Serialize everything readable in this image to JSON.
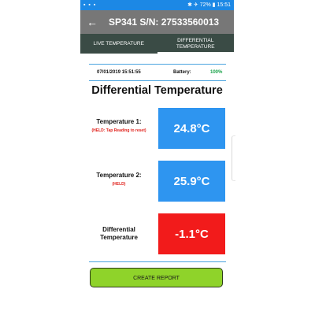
{
  "statusbar": {
    "left_icons": "▪ ▪ ▪",
    "right_text": "✱ ✈ 72% ▮ 15:51"
  },
  "appbar": {
    "back_icon": "←",
    "title": "SP341 S/N: 27533560013"
  },
  "tabs": [
    {
      "label": "LIVE TEMPERATURE",
      "active": false
    },
    {
      "label": "DIFFERENTIAL TEMPERATURE",
      "active": true
    }
  ],
  "info": {
    "datetime": "07/01/2019 15:51:55",
    "battery_label": "Battery:",
    "battery_value": "100%"
  },
  "page_title": "Differential Temperature",
  "readings": [
    {
      "label": "Temperature 1:",
      "hint": "(HELD: Tap Reading to reset)",
      "value": "24.8°C",
      "color": "#2e95f0"
    },
    {
      "label": "Temperature 2:",
      "hint": "(HELD)",
      "value": "25.9°C",
      "color": "#2e95f0"
    },
    {
      "label": "Differential Temperature",
      "hint": "",
      "value": "-1.1°C",
      "color": "#f21b1b"
    }
  ],
  "create_report_label": "CREATE REPORT",
  "colors": {
    "statusbar": "#1c88e5",
    "appbar": "#777777",
    "tabs": "#3a4b45",
    "battery_ok": "#1aa34a",
    "button": "#8fd32a"
  }
}
